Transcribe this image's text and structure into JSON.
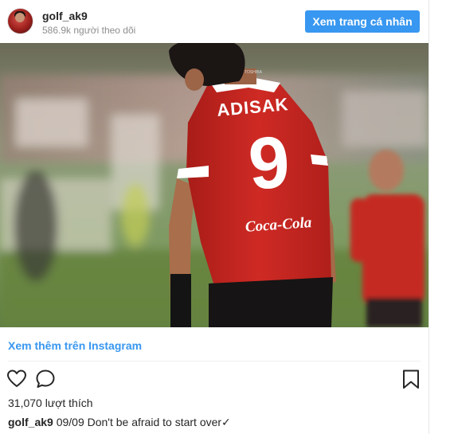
{
  "header": {
    "username": "golf_ak9",
    "followers": "586.9k người theo dõi",
    "profile_button": "Xem trang cá nhân"
  },
  "photo": {
    "jersey_name": "ADISAK",
    "jersey_number": "9",
    "sponsor": "Coca-Cola",
    "collar_brand": "TOSHIBA"
  },
  "links": {
    "view_more": "Xem thêm trên Instagram"
  },
  "actions": {
    "like_icon": "heart-outline-icon",
    "comment_icon": "speech-bubble-icon",
    "save_icon": "bookmark-outline-icon"
  },
  "stats": {
    "likes": "31,070 lượt thích"
  },
  "caption": {
    "username": "golf_ak9",
    "text": "09/09 Don't be afraid to start over✓"
  },
  "colors": {
    "accent": "#3897f0",
    "text": "#262626",
    "muted": "#8e8e8e",
    "jersey": "#c8231f"
  }
}
